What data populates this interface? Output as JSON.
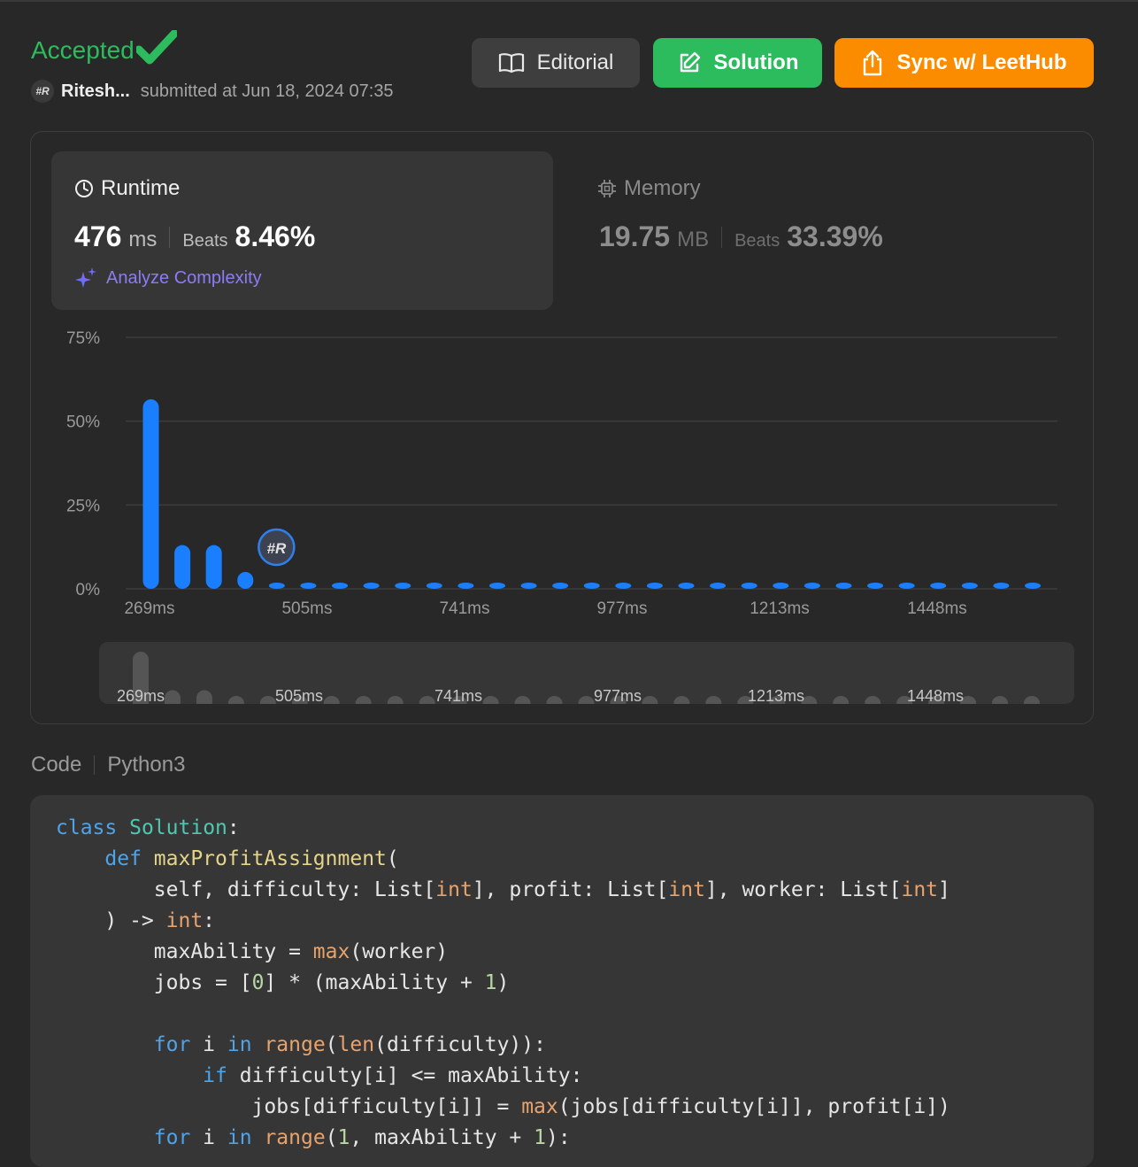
{
  "submission": {
    "status": "Accepted",
    "author": "Ritesh...",
    "submitted_text": "submitted at Jun 18, 2024 07:35",
    "avatar_text": "#R"
  },
  "buttons": {
    "editorial": "Editorial",
    "solution": "Solution",
    "sync": "Sync w/ LeetHub"
  },
  "runtime": {
    "title": "Runtime",
    "value": "476",
    "unit": "ms",
    "beats_label": "Beats",
    "beats_pct": "8.46%",
    "analyze": "Analyze Complexity"
  },
  "memory": {
    "title": "Memory",
    "value": "19.75",
    "unit": "MB",
    "beats_label": "Beats",
    "beats_pct": "33.39%"
  },
  "chart_data": {
    "type": "bar",
    "y_ticks": [
      "75%",
      "50%",
      "25%",
      "0%"
    ],
    "ylim": [
      0,
      75
    ],
    "x_tick_labels": [
      "269ms",
      "505ms",
      "741ms",
      "977ms",
      "1213ms",
      "1448ms"
    ],
    "values": [
      56,
      12.5,
      12.5,
      4.5,
      0.5,
      0.5,
      0.5,
      0.5,
      0.5,
      0.5,
      0.5,
      0.5,
      0.5,
      0.5,
      0.5,
      0.5,
      0.5,
      0.5,
      0.5,
      0.5,
      0.5,
      0.5,
      0.5,
      0.5,
      0.5,
      0.5,
      0.5,
      0.5,
      0.5
    ],
    "user_marker_label": "#R",
    "user_marker_bin": 4,
    "colors": {
      "bar": "#1a7fff",
      "grid": "#3c3c3c",
      "axis_text": "#9a9a9a"
    }
  },
  "code": {
    "label": "Code",
    "language": "Python3",
    "lines": [
      "class Solution:",
      "    def maxProfitAssignment(",
      "        self, difficulty: List[int], profit: List[int], worker: List[int]",
      "    ) -> int:",
      "        maxAbility = max(worker)",
      "        jobs = [0] * (maxAbility + 1)",
      "",
      "        for i in range(len(difficulty)):",
      "            if difficulty[i] <= maxAbility:",
      "                jobs[difficulty[i]] = max(jobs[difficulty[i]], profit[i])",
      "        for i in range(1, maxAbility + 1):"
    ]
  }
}
